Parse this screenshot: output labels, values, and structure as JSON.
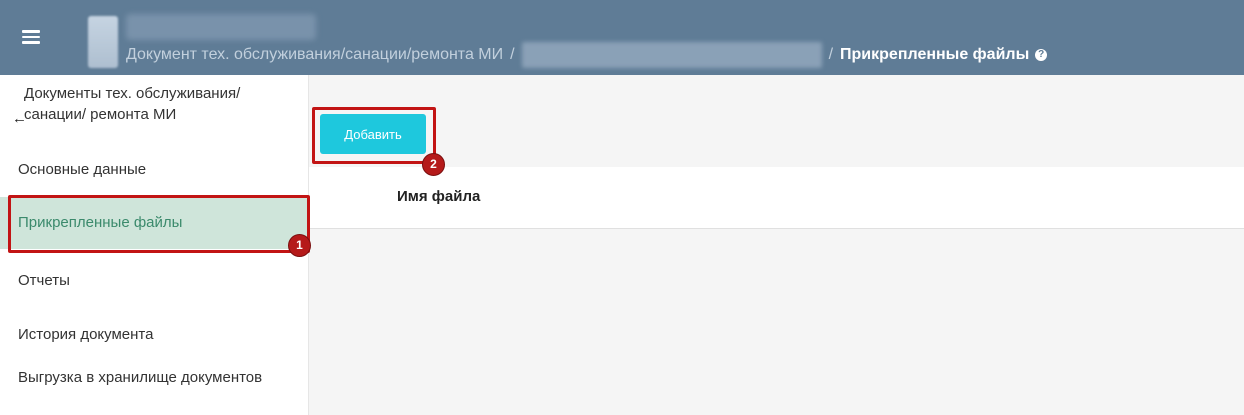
{
  "header": {
    "menu_icon": "hamburger-menu-icon",
    "breadcrumb": {
      "parent": "Документ тех. обслуживания/санации/ремонта МИ",
      "separator": "/",
      "current": "Прикрепленные файлы",
      "help_icon": "question-circle-icon",
      "help_glyph": "?"
    }
  },
  "sidebar": {
    "back": {
      "icon": "arrow-left-icon",
      "glyph": "←",
      "label": "Документы тех. обслуживания/санации/ ремонта МИ"
    },
    "items": [
      {
        "label": "Основные данные",
        "active": false
      },
      {
        "label": "Прикрепленные файлы",
        "active": true
      },
      {
        "label": "Отчеты",
        "active": false
      },
      {
        "label": "История документа",
        "active": false
      },
      {
        "label": "Выгрузка в хранилище документов",
        "active": false
      }
    ]
  },
  "main": {
    "add_button": "Добавить",
    "table": {
      "columns": [
        "Имя файла"
      ]
    }
  },
  "annotations": [
    {
      "number": "1"
    },
    {
      "number": "2"
    }
  ],
  "colors": {
    "header_bg": "#5f7c96",
    "active_item_bg": "#cfe5da",
    "active_item_text": "#3b8a6c",
    "add_button_bg": "#1ec8dd",
    "annotation_red": "#c21414"
  }
}
